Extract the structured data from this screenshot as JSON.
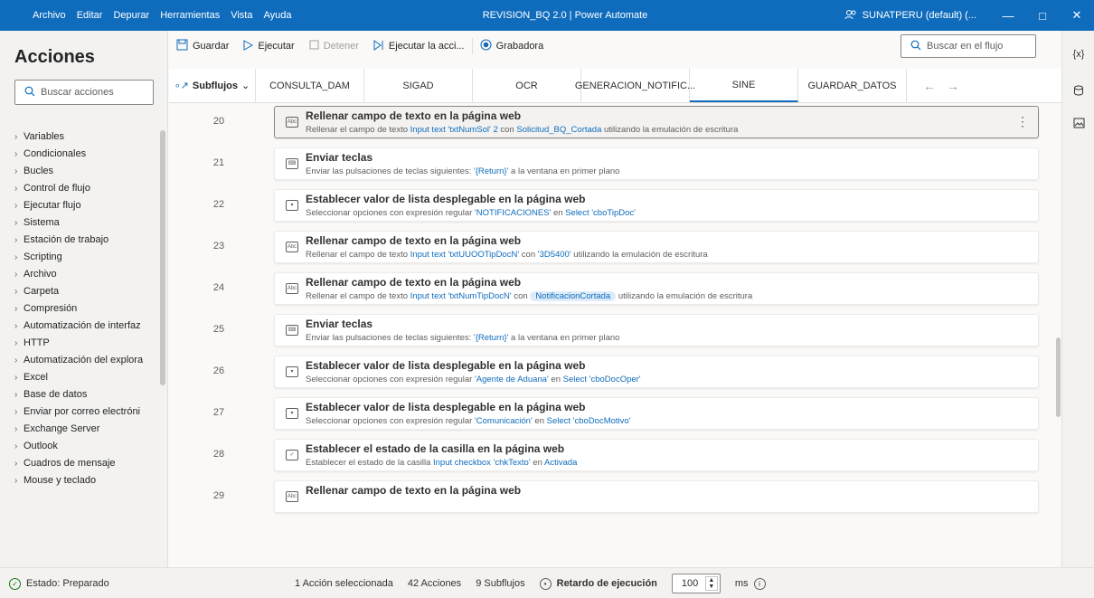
{
  "window": {
    "menus": [
      "Archivo",
      "Editar",
      "Depurar",
      "Herramientas",
      "Vista",
      "Ayuda"
    ],
    "title": "REVISION_BQ 2.0 | Power Automate",
    "account": "SUNATPERU (default) (..."
  },
  "left_pane": {
    "title": "Acciones",
    "search_placeholder": "Buscar acciones",
    "categories": [
      "Variables",
      "Condicionales",
      "Bucles",
      "Control de flujo",
      "Ejecutar flujo",
      "Sistema",
      "Estación de trabajo",
      "Scripting",
      "Archivo",
      "Carpeta",
      "Compresión",
      "Automatización de interfaz",
      "HTTP",
      "Automatización del explora",
      "Excel",
      "Base de datos",
      "Enviar por correo electróni",
      "Exchange Server",
      "Outlook",
      "Cuadros de mensaje",
      "Mouse y teclado"
    ]
  },
  "toolbar": {
    "save": "Guardar",
    "run": "Ejecutar",
    "stop": "Detener",
    "run_action": "Ejecutar la acci...",
    "recorder": "Grabadora",
    "flow_search_placeholder": "Buscar en el flujo"
  },
  "tabs": {
    "subflows_label": "Subflujos",
    "items": [
      "CONSULTA_DAM",
      "SIGAD",
      "OCR",
      "GENERACION_NOTIFIC...",
      "SINE",
      "GUARDAR_DATOS"
    ],
    "active": "SINE"
  },
  "right_rail": {
    "variables": "{x}"
  },
  "steps": [
    {
      "num": "20",
      "title": "Rellenar campo de texto en la página web",
      "icon": "text-field-icon",
      "parts": [
        "Rellenar el campo de texto ",
        "Input text 'txtNumSol' 2",
        " con ",
        "Solicitud_BQ_Cortada",
        " utilizando la emulación de escritura"
      ]
    },
    {
      "num": "21",
      "title": "Enviar teclas",
      "icon": "keyboard-icon",
      "parts": [
        "Enviar las pulsaciones de teclas siguientes: ",
        "'{Return}'",
        " a la ventana en primer plano"
      ]
    },
    {
      "num": "22",
      "title": "Establecer valor de lista desplegable en la página web",
      "icon": "dropdown-icon",
      "parts": [
        "Seleccionar opciones con expresión regular ",
        "'NOTIFICACIONES'",
        " en ",
        "Select 'cboTipDoc'"
      ]
    },
    {
      "num": "23",
      "title": "Rellenar campo de texto en la página web",
      "icon": "text-field-icon",
      "parts": [
        "Rellenar el campo de texto ",
        "Input text 'txtUUOOTipDocN'",
        " con ",
        "'3D5400'",
        " utilizando la emulación de escritura"
      ]
    },
    {
      "num": "24",
      "title": "Rellenar campo de texto en la página web",
      "icon": "text-field-icon",
      "parts": [
        "Rellenar el campo de texto ",
        "Input text 'txtNumTipDocN'",
        " con ",
        "NotificacionCortada",
        " utilizando la emulación de escritura"
      ]
    },
    {
      "num": "25",
      "title": "Enviar teclas",
      "icon": "keyboard-icon",
      "parts": [
        "Enviar las pulsaciones de teclas siguientes: ",
        "'{Return}'",
        " a la ventana en primer plano"
      ]
    },
    {
      "num": "26",
      "title": "Establecer valor de lista desplegable en la página web",
      "icon": "dropdown-icon",
      "parts": [
        "Seleccionar opciones con expresión regular ",
        "'Agente de Aduana'",
        " en ",
        "Select 'cboDocOper'"
      ]
    },
    {
      "num": "27",
      "title": "Establecer valor de lista desplegable en la página web",
      "icon": "dropdown-icon",
      "parts": [
        "Seleccionar opciones con expresión regular ",
        "'Comunicación'",
        " en ",
        "Select 'cboDocMotivo'"
      ]
    },
    {
      "num": "28",
      "title": "Establecer el estado de la casilla en la página web",
      "icon": "checkbox-icon",
      "parts": [
        "Establecer el estado de la casilla ",
        "Input checkbox 'chkTexto'",
        " en ",
        "Activada"
      ]
    },
    {
      "num": "29",
      "title": "Rellenar campo de texto en la página web",
      "icon": "text-field-icon",
      "parts": [
        "",
        "",
        "",
        "",
        ""
      ]
    }
  ],
  "status": {
    "state": "Estado: Preparado",
    "selected": "1 Acción seleccionada",
    "actions": "42 Acciones",
    "subflows": "9 Subflujos",
    "delay_label": "Retardo de ejecución",
    "delay_value": "100",
    "delay_unit": "ms"
  }
}
